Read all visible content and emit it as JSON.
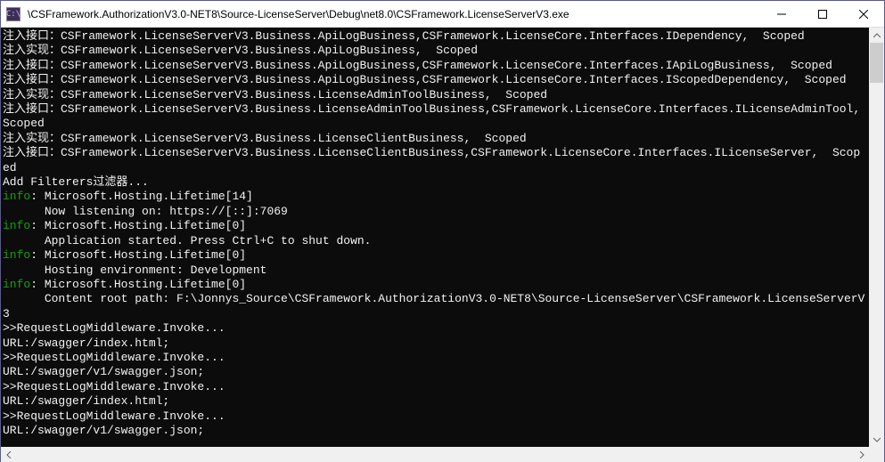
{
  "window": {
    "icon_label": "C:\\",
    "title_prefix": "            ",
    "title_path": "\\CSFramework.AuthorizationV3.0-NET8\\Source-LicenseServer\\Debug\\net8.0\\CSFramework.LicenseServerV3.exe"
  },
  "controls": {
    "minimize": "minimize",
    "maximize": "maximize",
    "close": "close"
  },
  "console_lines": [
    {
      "segments": [
        {
          "cls": "white",
          "text": "注入接口：CSFramework.LicenseServerV3.Business.ApiLogBusiness,CSFramework.LicenseCore.Interfaces.IDependency,  Scoped"
        }
      ]
    },
    {
      "segments": [
        {
          "cls": "white",
          "text": "注入实现：CSFramework.LicenseServerV3.Business.ApiLogBusiness,  Scoped"
        }
      ]
    },
    {
      "segments": [
        {
          "cls": "white",
          "text": "注入接口：CSFramework.LicenseServerV3.Business.ApiLogBusiness,CSFramework.LicenseCore.Interfaces.IApiLogBusiness,  Scoped"
        }
      ]
    },
    {
      "segments": [
        {
          "cls": "white",
          "text": "注入接口：CSFramework.LicenseServerV3.Business.ApiLogBusiness,CSFramework.LicenseCore.Interfaces.IScopedDependency,  Scoped"
        }
      ]
    },
    {
      "segments": [
        {
          "cls": "white",
          "text": "注入实现：CSFramework.LicenseServerV3.Business.LicenseAdminToolBusiness,  Scoped"
        }
      ]
    },
    {
      "segments": [
        {
          "cls": "white",
          "text": "注入接口：CSFramework.LicenseServerV3.Business.LicenseAdminToolBusiness,CSFramework.LicenseCore.Interfaces.ILicenseAdminTool,  Scoped"
        }
      ]
    },
    {
      "segments": [
        {
          "cls": "white",
          "text": "注入实现：CSFramework.LicenseServerV3.Business.LicenseClientBusiness,  Scoped"
        }
      ]
    },
    {
      "segments": [
        {
          "cls": "white",
          "text": "注入接口：CSFramework.LicenseServerV3.Business.LicenseClientBusiness,CSFramework.LicenseCore.Interfaces.ILicenseServer,  Scoped"
        }
      ]
    },
    {
      "segments": [
        {
          "cls": "white",
          "text": "Add Filterers过滤器..."
        }
      ]
    },
    {
      "segments": [
        {
          "cls": "info",
          "text": "info"
        },
        {
          "cls": "white",
          "text": ": Microsoft.Hosting.Lifetime[14]"
        }
      ]
    },
    {
      "segments": [
        {
          "cls": "white",
          "text": "      Now listening on: https://[::]:7069"
        }
      ]
    },
    {
      "segments": [
        {
          "cls": "info",
          "text": "info"
        },
        {
          "cls": "white",
          "text": ": Microsoft.Hosting.Lifetime[0]"
        }
      ]
    },
    {
      "segments": [
        {
          "cls": "white",
          "text": "      Application started. Press Ctrl+C to shut down."
        }
      ]
    },
    {
      "segments": [
        {
          "cls": "info",
          "text": "info"
        },
        {
          "cls": "white",
          "text": ": Microsoft.Hosting.Lifetime[0]"
        }
      ]
    },
    {
      "segments": [
        {
          "cls": "white",
          "text": "      Hosting environment: Development"
        }
      ]
    },
    {
      "segments": [
        {
          "cls": "info",
          "text": "info"
        },
        {
          "cls": "white",
          "text": ": Microsoft.Hosting.Lifetime[0]"
        }
      ]
    },
    {
      "segments": [
        {
          "cls": "white",
          "text": "      Content root path: F:\\Jonnys_Source\\CSFramework.AuthorizationV3.0-NET8\\Source-LicenseServer\\CSFramework.LicenseServerV3"
        }
      ]
    },
    {
      "segments": [
        {
          "cls": "white",
          "text": ">>RequestLogMiddleware.Invoke..."
        }
      ]
    },
    {
      "segments": [
        {
          "cls": "white",
          "text": "URL:/swagger/index.html;"
        }
      ]
    },
    {
      "segments": [
        {
          "cls": "white",
          "text": ">>RequestLogMiddleware.Invoke..."
        }
      ]
    },
    {
      "segments": [
        {
          "cls": "white",
          "text": "URL:/swagger/v1/swagger.json;"
        }
      ]
    },
    {
      "segments": [
        {
          "cls": "white",
          "text": ">>RequestLogMiddleware.Invoke..."
        }
      ]
    },
    {
      "segments": [
        {
          "cls": "white",
          "text": "URL:/swagger/index.html;"
        }
      ]
    },
    {
      "segments": [
        {
          "cls": "white",
          "text": ">>RequestLogMiddleware.Invoke..."
        }
      ]
    },
    {
      "segments": [
        {
          "cls": "white",
          "text": "URL:/swagger/v1/swagger.json;"
        }
      ]
    }
  ]
}
